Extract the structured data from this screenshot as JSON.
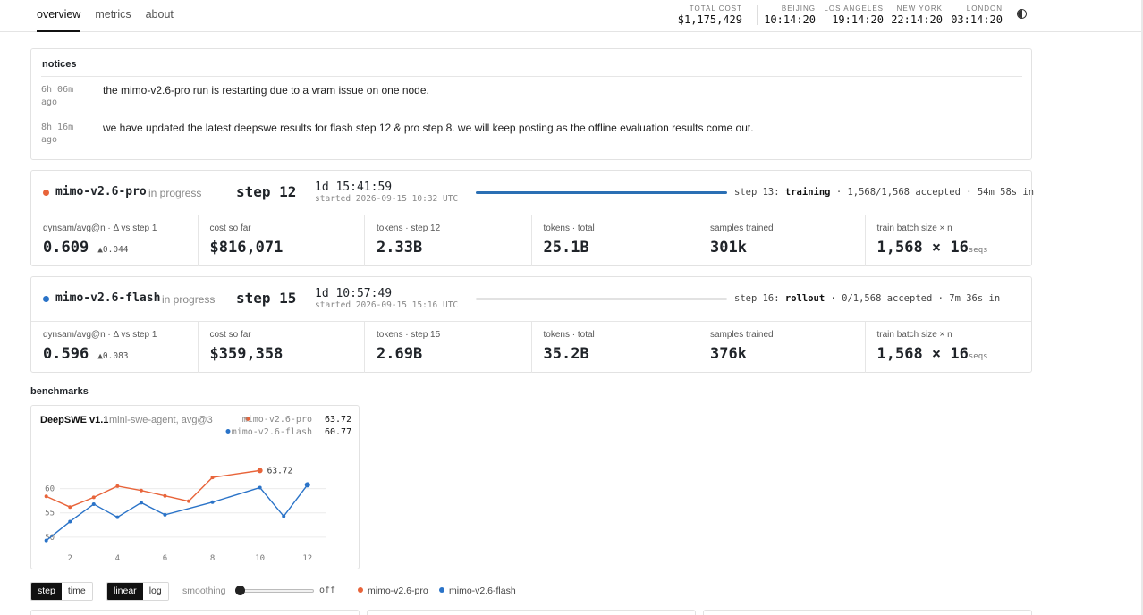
{
  "nav": {
    "items": [
      {
        "label": "overview",
        "active": true
      },
      {
        "label": "metrics"
      },
      {
        "label": "about"
      }
    ]
  },
  "header": {
    "total_cost": {
      "label": "TOTAL COST",
      "value": "$1,175,429"
    },
    "clocks": [
      {
        "label": "BEIJING",
        "time": "10:14:20"
      },
      {
        "label": "LOS ANGELES",
        "time": "19:14:20"
      },
      {
        "label": "NEW YORK",
        "time": "22:14:20"
      },
      {
        "label": "LONDON",
        "time": "03:14:20"
      }
    ],
    "theme_icon": "half-circle-icon"
  },
  "notices": {
    "title": "notices",
    "items": [
      {
        "when": "6h 06m ago",
        "text": "the mimo-v2.6-pro run is restarting due to a vram issue on one node."
      },
      {
        "when": "8h 16m ago",
        "text": "we have updated the latest deepswe results for flash step 12 & pro step 8. we will keep posting as the offline evaluation results come out."
      }
    ]
  },
  "runs": [
    {
      "name": "mimo-v2.6-pro",
      "color": "#e8643a",
      "status": "in progress",
      "step": "step 12",
      "duration": "1d 15:41:59",
      "started": "started 2026-09-15 10:32 UTC",
      "progress": 1.0,
      "next_prefix": "step 13:",
      "next_phase": "training",
      "next_suffix": "· 1,568/1,568 accepted · 54m 58s in",
      "metrics": [
        {
          "label": "dynsam/avg@n · Δ vs step 1",
          "value": "0.609",
          "delta": "▲0.044"
        },
        {
          "label": "cost so far",
          "value": "$816,071"
        },
        {
          "label": "tokens · step 12",
          "value": "2.33B"
        },
        {
          "label": "tokens · total",
          "value": "25.1B"
        },
        {
          "label": "samples trained",
          "value": "301k"
        },
        {
          "label": "train batch size × n",
          "value": "1,568 × 16",
          "unit": "seqs"
        }
      ]
    },
    {
      "name": "mimo-v2.6-flash",
      "color": "#2a73c8",
      "status": "in progress",
      "step": "step 15",
      "duration": "1d 10:57:49",
      "started": "started 2026-09-15 15:16 UTC",
      "progress": 0.0,
      "next_prefix": "step 16:",
      "next_phase": "rollout",
      "next_suffix": "· 0/1,568 accepted · 7m 36s in",
      "metrics": [
        {
          "label": "dynsam/avg@n · Δ vs step 1",
          "value": "0.596",
          "delta": "▲0.083"
        },
        {
          "label": "cost so far",
          "value": "$359,358"
        },
        {
          "label": "tokens · step 15",
          "value": "2.69B"
        },
        {
          "label": "tokens · total",
          "value": "35.2B"
        },
        {
          "label": "samples trained",
          "value": "376k"
        },
        {
          "label": "train batch size × n",
          "value": "1,568 × 16",
          "unit": "seqs"
        }
      ]
    }
  ],
  "benchmarks": {
    "title": "benchmarks"
  },
  "chart_data": {
    "type": "line",
    "title": "DeepSWE v1.1",
    "subtitle": "mini-swe-agent, avg@3",
    "xlim": [
      1.2,
      12.8
    ],
    "ylim": [
      48.5,
      66
    ],
    "xticks": [
      2,
      4,
      6,
      8,
      10,
      12
    ],
    "yticks": [
      50,
      55,
      60
    ],
    "grid": true,
    "legend": "top-right",
    "series": [
      {
        "name": "mimo-v2.6-pro",
        "color": "#e8643a",
        "legend_value": "63.72",
        "end_label": "63.72",
        "x": [
          1,
          2,
          3,
          4,
          5,
          6,
          7,
          8,
          10
        ],
        "y": [
          58.4,
          56.2,
          58.2,
          60.5,
          59.6,
          58.5,
          57.4,
          62.3,
          63.72
        ]
      },
      {
        "name": "mimo-v2.6-flash",
        "color": "#2a73c8",
        "legend_value": "60.77",
        "x": [
          1,
          2,
          3,
          4,
          5,
          6,
          8,
          10,
          11,
          12
        ],
        "y": [
          49.3,
          53.2,
          56.8,
          54.1,
          57.1,
          54.6,
          57.2,
          60.2,
          54.3,
          60.77
        ]
      }
    ]
  },
  "controls": {
    "xaxis": [
      {
        "label": "step",
        "active": true
      },
      {
        "label": "time"
      }
    ],
    "scale": [
      {
        "label": "linear",
        "active": true
      },
      {
        "label": "log"
      }
    ],
    "smoothing_label": "smoothing",
    "smoothing_value": 0,
    "smoothing_readout": "off",
    "legend": [
      {
        "name": "mimo-v2.6-pro",
        "color": "#e8643a"
      },
      {
        "name": "mimo-v2.6-flash",
        "color": "#2a73c8"
      }
    ]
  }
}
